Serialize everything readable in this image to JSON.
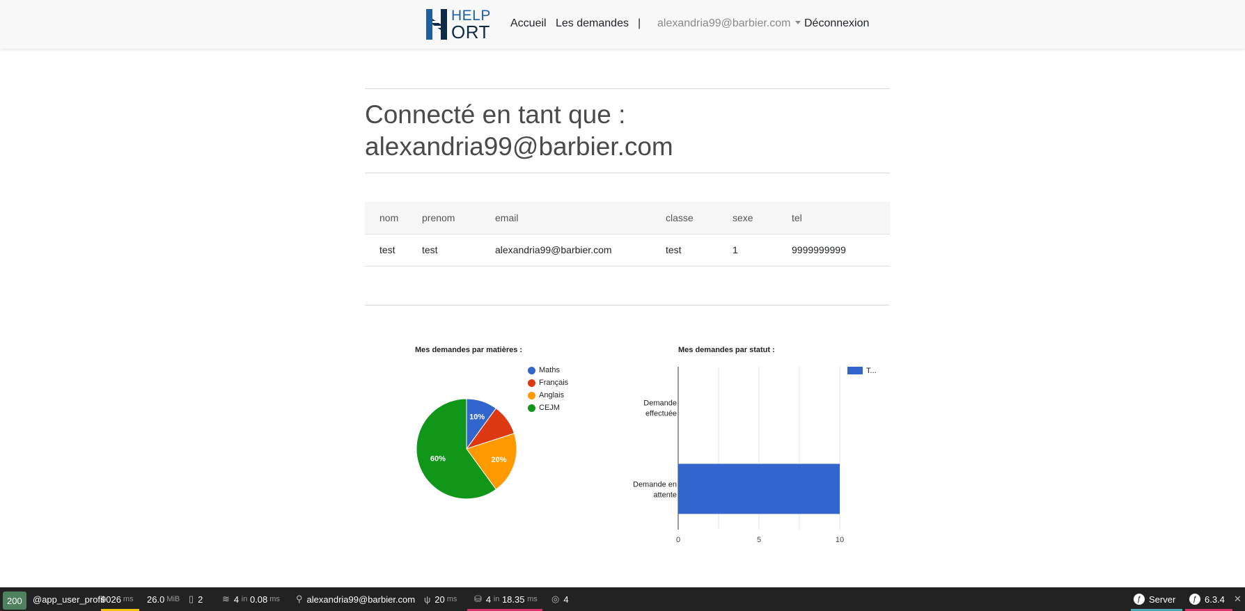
{
  "navbar": {
    "brand_line1": "HELP",
    "brand_line2": "ORT",
    "links": [
      "Accueil",
      "Les demandes"
    ],
    "separator": "|",
    "user_email": "alexandria99@barbier.com",
    "logout": "Déconnexion"
  },
  "main": {
    "title_line1": "Connecté en tant que :",
    "title_line2": "alexandria99@barbier.com",
    "table": {
      "headers": [
        "nom",
        "prenom",
        "email",
        "classe",
        "sexe",
        "tel"
      ],
      "rows": [
        [
          "test",
          "test",
          "alexandria99@barbier.com",
          "test",
          "1",
          "9999999999"
        ]
      ]
    }
  },
  "chart_data": [
    {
      "type": "pie",
      "title": "Mes demandes par matières :",
      "categories": [
        "Maths",
        "Français",
        "Anglais",
        "CEJM"
      ],
      "values": [
        10,
        10,
        20,
        60
      ],
      "labels": [
        "10%",
        "",
        "20%",
        "60%"
      ],
      "colors": [
        "#3366cc",
        "#dc3912",
        "#ff9900",
        "#109618"
      ],
      "legend": "right"
    },
    {
      "type": "bar",
      "orientation": "horizontal",
      "title": "Mes demandes par statut :",
      "categories": [
        "Demande effectuée",
        "Demande en attente"
      ],
      "series": [
        {
          "name": "T...",
          "values": [
            0,
            10
          ]
        }
      ],
      "xlim": [
        0,
        10
      ],
      "xticks": [
        "0",
        "5",
        "10"
      ],
      "color": "#3366cc",
      "legend": "top-right"
    }
  ],
  "toolbar": {
    "status": "200",
    "route": "@app_user_profil",
    "time_value": "9026",
    "time_unit": "ms",
    "memory_value": "26.0",
    "memory_unit": "MiB",
    "forms": "2",
    "cache_value": "4",
    "cache_in": "in",
    "cache_time": "0.08",
    "cache_unit": "ms",
    "user": "alexandria99@barbier.com",
    "twig_value": "20",
    "twig_unit": "ms",
    "db_value": "4",
    "db_in": "in",
    "db_time": "18.35",
    "db_unit": "ms",
    "http_count": "4",
    "server": "Server",
    "version": "6.3.4",
    "close": "✕"
  }
}
